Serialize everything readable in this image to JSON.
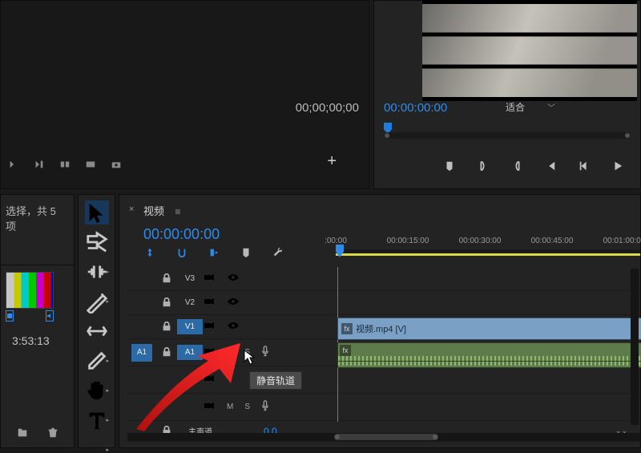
{
  "source": {
    "timecode": "00;00;00;00"
  },
  "program": {
    "timecode": "00:00:00:00",
    "fit_label": "适合"
  },
  "project": {
    "selection_text": "选择，共 5 项",
    "clip_duration": "3:53:13"
  },
  "timeline": {
    "sequence_name": "视频",
    "timecode": "00:00:00:00",
    "ruler": [
      ":00:00",
      "00:00:15:00",
      "00:00:30:00",
      "00:00:45:00",
      "00:01:00:00"
    ],
    "tracks": {
      "v3": {
        "name": "V3"
      },
      "v2": {
        "name": "V2"
      },
      "v1": {
        "name": "V1"
      },
      "a1": {
        "name": "A1",
        "src": "A1"
      },
      "a2": {
        "name": ""
      },
      "a3": {
        "name": ""
      },
      "master": {
        "name": "主声道",
        "value": "0.0"
      }
    },
    "clip_v1": {
      "label": "视频.mp4 [V]"
    },
    "tooltip": "静音轨道",
    "mute_char": "M",
    "solo_char": "S"
  }
}
